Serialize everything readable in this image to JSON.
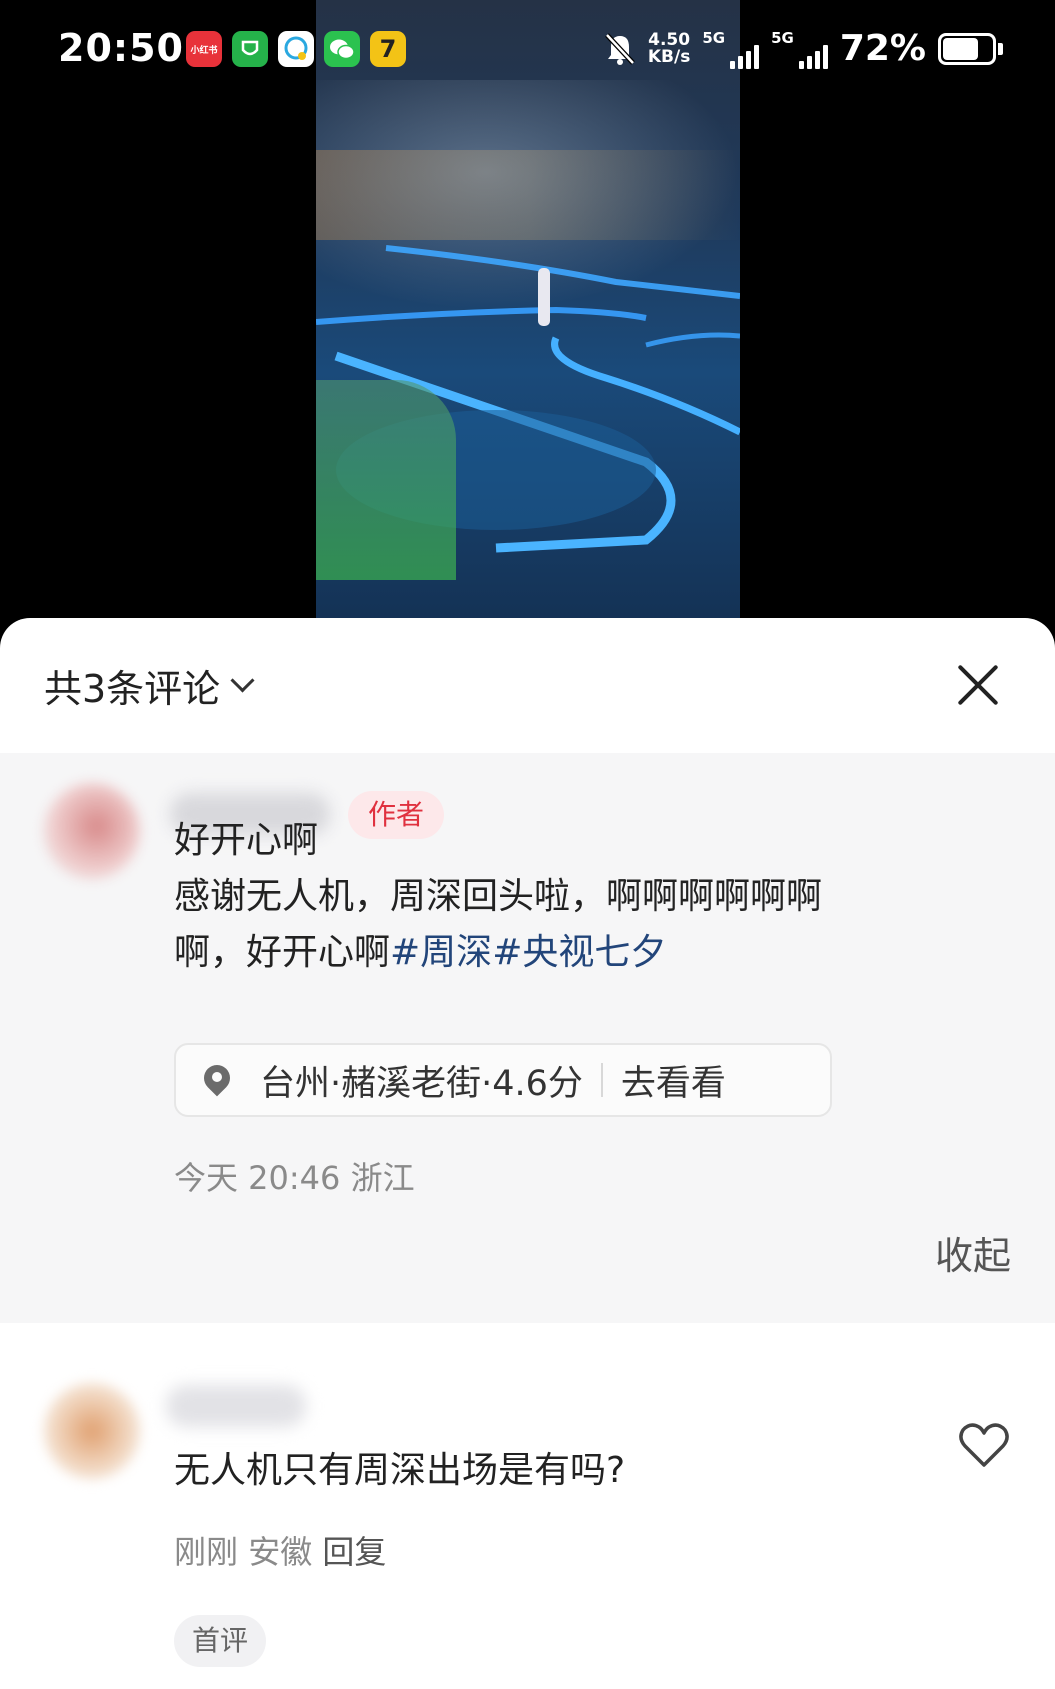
{
  "status_bar": {
    "time": "20:50",
    "network_speed_value": "4.50",
    "network_speed_unit": "KB/s",
    "sim1_label": "5G",
    "sim2_label": "5G",
    "battery_percent": "72%",
    "battery_level": 0.72,
    "app_icons": [
      {
        "name": "xiaohongshu-icon",
        "label": "小红书",
        "color": "#e8323a"
      },
      {
        "name": "shield-app-icon",
        "label": "",
        "color": "#25b24a"
      },
      {
        "name": "chat-bubble-app-icon",
        "label": "",
        "color": "#2aa8e0"
      },
      {
        "name": "wechat-icon",
        "label": "",
        "color": "#2bc24f"
      },
      {
        "name": "seven-app-icon",
        "label": "7",
        "color": "#f3c316"
      }
    ]
  },
  "comments_sheet": {
    "header": {
      "title": "共3条评论"
    },
    "author_comment": {
      "badge": "作者",
      "title": "好开心啊",
      "body_line1": "感谢无人机，周深回头啦，啊啊啊啊啊啊",
      "body_line2_text": "啊，好开心啊",
      "hashtags": [
        "#周深",
        "#央视七夕"
      ],
      "location": {
        "place": "台州·赭溪老街·4.6分",
        "action": "去看看"
      },
      "meta": "今天 20:46 浙江",
      "collapse_label": "收起"
    },
    "reply_comment": {
      "text": "无人机只有周深出场是有吗?",
      "time": "刚刚",
      "region": "安徽",
      "reply_label": "回复",
      "badge": "首评"
    }
  },
  "colors": {
    "author_badge_text": "#e0313f",
    "hashtag": "#22457a",
    "block_bg": "#f6f6f7"
  }
}
